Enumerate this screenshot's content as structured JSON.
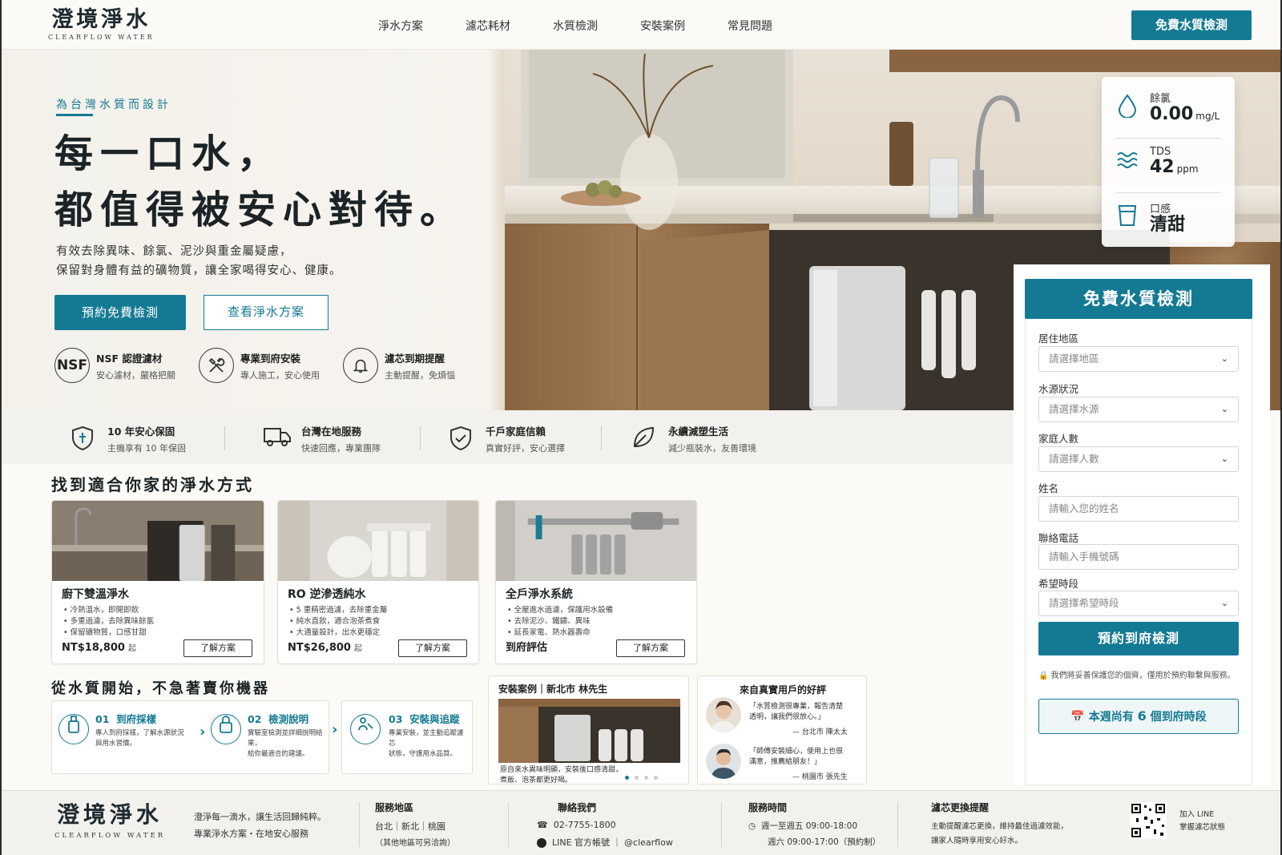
{
  "brand": {
    "name_cn": "澄境淨水",
    "name_en": "CLEARFLOW WATER"
  },
  "nav": {
    "items": [
      "淨水方案",
      "濾芯耗材",
      "水質檢測",
      "安裝案例",
      "常見問題"
    ],
    "cta": "免費水質檢測"
  },
  "hero": {
    "eyebrow": "為台灣水質而設計",
    "title_line1": "每一口水，",
    "title_line2": "都值得被安心對待。",
    "desc_line1": "有效去除異味、餘氯、泥沙與重金屬疑慮，",
    "desc_line2": "保留對身體有益的礦物質，讓全家喝得安心、健康。",
    "btn_primary": "預約免費檢測",
    "btn_secondary": "查看淨水方案",
    "features": [
      {
        "icon": "nsf-badge-icon",
        "icon_text": "NSF",
        "title": "NSF 認證濾材",
        "sub": "安心濾材，嚴格把關"
      },
      {
        "icon": "tools-icon",
        "title": "專業到府安裝",
        "sub": "專人施工，安心使用"
      },
      {
        "icon": "bell-icon",
        "title": "濾芯到期提醒",
        "sub": "主動提醒，免煩惱"
      }
    ]
  },
  "stats": [
    {
      "icon": "water-drop-icon",
      "label": "餘氯",
      "value": "0.00",
      "unit": "mg/L"
    },
    {
      "icon": "waves-icon",
      "label": "TDS",
      "value": "42",
      "unit": "ppm"
    },
    {
      "icon": "cup-icon",
      "label": "口感",
      "value": "清甜",
      "unit": ""
    }
  ],
  "form": {
    "title": "免費水質檢測",
    "fields": [
      {
        "label": "居住地區",
        "placeholder": "請選擇地區",
        "type": "select"
      },
      {
        "label": "水源狀況",
        "placeholder": "請選擇水源",
        "type": "select"
      },
      {
        "label": "家庭人數",
        "placeholder": "請選擇人數",
        "type": "select"
      },
      {
        "label": "姓名",
        "placeholder": "請輸入您的姓名",
        "type": "text"
      },
      {
        "label": "聯絡電話",
        "placeholder": "請輸入手機號碼",
        "type": "text"
      },
      {
        "label": "希望時段",
        "placeholder": "請選擇希望時段",
        "type": "select"
      }
    ],
    "submit": "預約到府檢測",
    "privacy": "我們將妥善保護您的個資，僅用於預約聯繫與服務。",
    "slots_prefix": "本週尚有",
    "slots_count": "6",
    "slots_suffix": "個到府時段"
  },
  "trust": [
    {
      "icon": "shield-icon",
      "title": "10 年安心保固",
      "sub": "主機享有 10 年保固"
    },
    {
      "icon": "truck-icon",
      "title": "台灣在地服務",
      "sub": "快速回應，專業團隊"
    },
    {
      "icon": "shield-check-icon",
      "title": "千戶家庭信賴",
      "sub": "真實好評，安心選擇"
    },
    {
      "icon": "leaf-icon",
      "title": "永續減塑生活",
      "sub": "減少瓶裝水，友善環境"
    }
  ],
  "plans": {
    "section_title": "找到適合你家的淨水方式",
    "cards": [
      {
        "title": "廚下雙溫淨水",
        "bullets": [
          "冷熱溫水，即開即飲",
          "多重過濾，去除異味餘氯",
          "保留礦物質，口感甘甜"
        ],
        "price": "NT$18,800",
        "price_suffix": "起",
        "btn": "了解方案"
      },
      {
        "title": "RO 逆滲透純水",
        "bullets": [
          "5 重精密過濾，去除重金屬",
          "純水直飲，適合泡茶煮食",
          "大通量設計，出水更穩定"
        ],
        "price": "NT$26,800",
        "price_suffix": "起",
        "btn": "了解方案"
      },
      {
        "title": "全戶淨水系統",
        "bullets": [
          "全屋進水過濾，保護用水設備",
          "去除泥沙、鐵鏽、異味",
          "延長家電、熱水器壽命"
        ],
        "price": "到府評估",
        "price_suffix": "",
        "btn": "了解方案"
      }
    ]
  },
  "process": {
    "section_title": "從水質開始，不急著賣你機器",
    "steps": [
      {
        "num": "01",
        "title": "到府採樣",
        "icon": "sample-bottle-icon",
        "desc": [
          "專人到府採樣，了解水源狀況",
          "與用水習慣。"
        ]
      },
      {
        "num": "02",
        "title": "檢測說明",
        "icon": "lock-report-icon",
        "desc": [
          "實驗室檢測並詳細說明結",
          "果，",
          "給你最適合的建議。"
        ]
      },
      {
        "num": "03",
        "title": "安裝與追蹤",
        "icon": "wrench-person-icon",
        "desc": [
          "專業安裝，並主動追蹤濾芯",
          "狀態，守護用水品質。"
        ]
      }
    ]
  },
  "case": {
    "title": "安裝案例｜新北市 林先生",
    "caption_line1": "原自來水異味明顯，安裝後口感清甜，",
    "caption_line2": "煮飯、泡茶都更好喝。",
    "dots_total": 4,
    "dots_active": 1
  },
  "reviews": {
    "title": "來自真實用戶的好評",
    "items": [
      {
        "quote_line1": "「水質檢測很專業，報告清楚",
        "quote_line2": "透明，讓我們很放心。」",
        "by": "— 台北市 陳太太"
      },
      {
        "quote_line1": "「師傅安裝細心，使用上也很",
        "quote_line2": "滿意，推薦給朋友！」",
        "by": "— 桃園市 張先生"
      }
    ]
  },
  "footer": {
    "slogan_line1": "澄淨每一滴水，讓生活回歸純粹。",
    "slogan_line2": "專業淨水方案・在地安心服務",
    "service_area_title": "服務地區",
    "service_area": "台北｜新北｜桃園",
    "service_area_note": "（其他地區可另洽詢）",
    "contact_title": "聯絡我們",
    "phone": "02-7755-1800",
    "line": "LINE 官方帳號 ｜ @clearflow",
    "hours_title": "服務時間",
    "hours_weekday": "週一至週五 09:00-18:00",
    "hours_weekend": "週六 09:00-17:00（預約制）",
    "filter_title": "濾芯更換提醒",
    "filter_line1": "主動提醒濾芯更換，維持最佳過濾效能，",
    "filter_line2": "讓家人隨時享用安心好水。",
    "line_cta_1": "加入 LINE",
    "line_cta_2": "掌握濾芯狀態"
  }
}
